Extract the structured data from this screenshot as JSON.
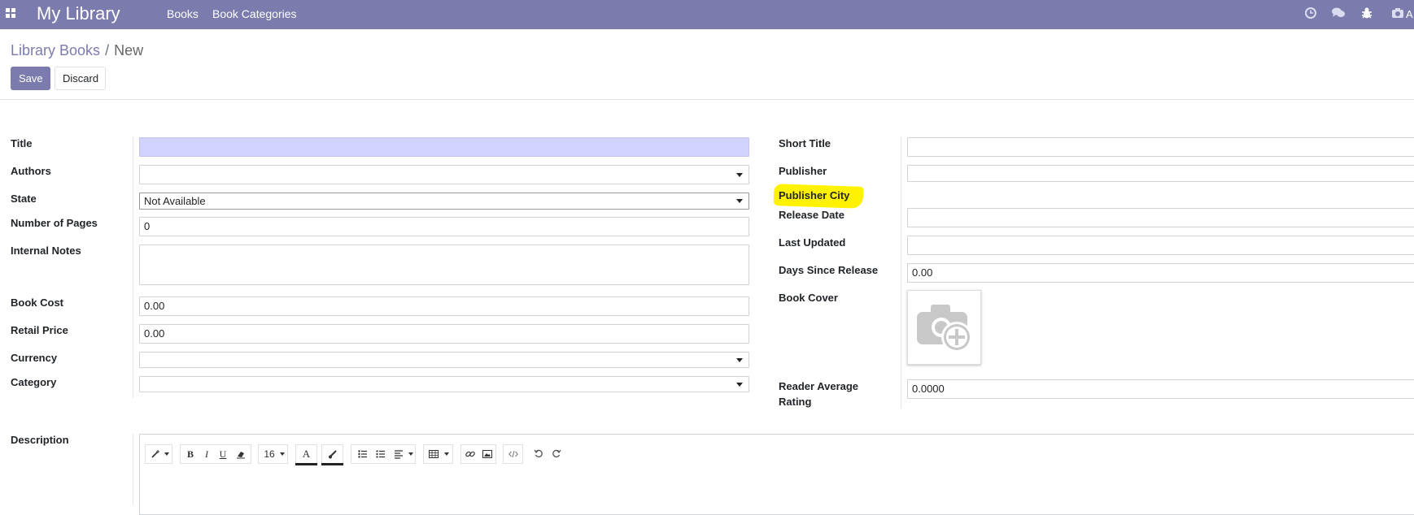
{
  "navbar": {
    "brand": "My Library",
    "menu": [
      "Books",
      "Book Categories"
    ],
    "user_initial": "A",
    "icons": [
      "apps-grid-icon",
      "clock-icon",
      "chat-icon",
      "bug-icon",
      "camera-icon"
    ]
  },
  "breadcrumb": {
    "parent": "Library Books",
    "separator": "/",
    "current": "New"
  },
  "buttons": {
    "save": "Save",
    "discard": "Discard"
  },
  "form_left": {
    "title": {
      "label": "Title",
      "value": ""
    },
    "authors": {
      "label": "Authors",
      "value": ""
    },
    "state": {
      "label": "State",
      "value": "Not Available"
    },
    "pages": {
      "label": "Number of Pages",
      "value": "0"
    },
    "notes": {
      "label": "Internal Notes",
      "value": ""
    },
    "cost": {
      "label": "Book Cost",
      "value": "0.00"
    },
    "retail": {
      "label": "Retail Price",
      "value": "0.00"
    },
    "currency": {
      "label": "Currency",
      "value": ""
    },
    "category": {
      "label": "Category",
      "value": ""
    }
  },
  "form_right": {
    "short_title": {
      "label": "Short Title",
      "value": ""
    },
    "publisher": {
      "label": "Publisher",
      "value": ""
    },
    "publisher_city": {
      "label": "Publisher City"
    },
    "release_date": {
      "label": "Release Date",
      "value": ""
    },
    "last_updated": {
      "label": "Last Updated",
      "value": ""
    },
    "days_since_release": {
      "label": "Days Since Release",
      "value": "0.00"
    },
    "book_cover": {
      "label": "Book Cover"
    },
    "reader_rating": {
      "label_line1": "Reader Average",
      "label_line2": "Rating",
      "value": "0.0000"
    }
  },
  "description": {
    "label": "Description",
    "font_size": "16"
  },
  "colors": {
    "brand": "#7c7bad",
    "required_field": "#d2d2ff",
    "highlight": "#fff200"
  }
}
